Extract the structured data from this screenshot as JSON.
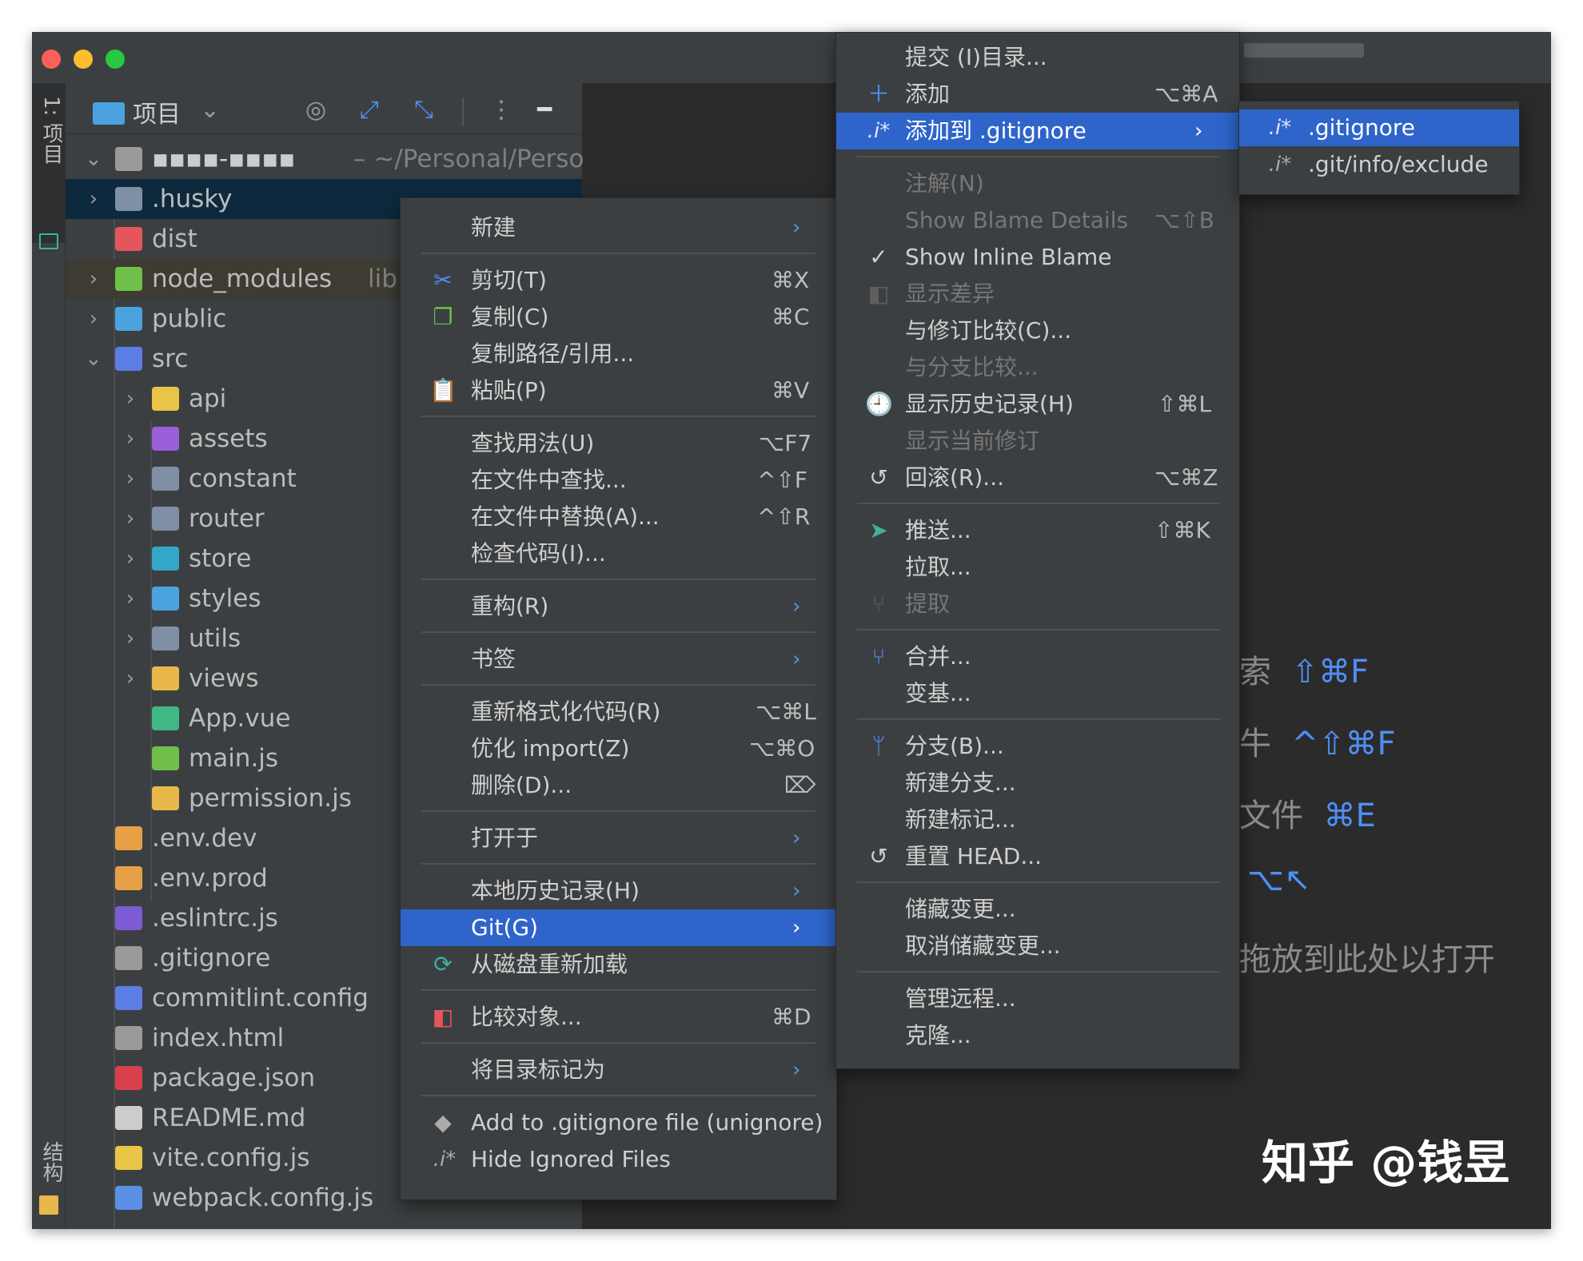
{
  "project_panel": {
    "tab_label": "1: 项目",
    "structure_tab_label": "结构",
    "toolbar_label": "项目",
    "toolbar_chevron": "⌄",
    "root_name": "▪▪▪▪-▪▪▪▪",
    "root_path": "~/Personal/Perso",
    "items": [
      {
        "name": ".husky",
        "icon_color": "#7f8fa6"
      },
      {
        "name": "dist",
        "icon_color": "#e5565c"
      },
      {
        "name": "node_modules",
        "sub": "lib",
        "icon_color": "#6fbf4a"
      },
      {
        "name": "public",
        "icon_color": "#4aa3df"
      },
      {
        "name": "src",
        "icon_color": "#5b7ee5"
      },
      {
        "name": "api",
        "icon_color": "#e8c547"
      },
      {
        "name": "assets",
        "icon_color": "#9a5ed8"
      },
      {
        "name": "constant",
        "icon_color": "#7f8fa6"
      },
      {
        "name": "router",
        "icon_color": "#7f8fa6"
      },
      {
        "name": "store",
        "icon_color": "#34a6c8"
      },
      {
        "name": "styles",
        "icon_color": "#4aa3df"
      },
      {
        "name": "utils",
        "icon_color": "#7f8fa6"
      },
      {
        "name": "views",
        "icon_color": "#e8b84b"
      },
      {
        "name": "App.vue",
        "icon_color": "#41b883"
      },
      {
        "name": "main.js",
        "icon_color": "#6fbf4a"
      },
      {
        "name": "permission.js",
        "icon_color": "#e8b84b"
      },
      {
        "name": ".env.dev",
        "icon_color": "#e8a047"
      },
      {
        "name": ".env.prod",
        "icon_color": "#e8a047"
      },
      {
        "name": ".eslintrc.js",
        "icon_color": "#7e5bd6"
      },
      {
        "name": ".gitignore",
        "icon_color": "#9a9a9a"
      },
      {
        "name": "commitlint.config",
        "icon_color": "#5b7ee5"
      },
      {
        "name": "index.html",
        "icon_color": "#9a9a9a"
      },
      {
        "name": "package.json",
        "icon_color": "#d9404b"
      },
      {
        "name": "README.md",
        "icon_color": "#cccccc"
      },
      {
        "name": "vite.config.js",
        "icon_color": "#e8c547"
      },
      {
        "name": "webpack.config.js",
        "icon_color": "#5b8fe6"
      }
    ]
  },
  "context_menu": {
    "new": "新建",
    "cut": "剪切(T)",
    "cut_sc": "⌘X",
    "copy": "复制(C)",
    "copy_sc": "⌘C",
    "copy_path": "复制路径/引用...",
    "paste": "粘贴(P)",
    "paste_sc": "⌘V",
    "find_usages": "查找用法(U)",
    "find_usages_sc": "⌥F7",
    "find_in_files": "在文件中查找...",
    "find_in_files_sc": "^⇧F",
    "replace_in_files": "在文件中替换(A)...",
    "replace_in_files_sc": "^⇧R",
    "inspect_code": "检查代码(I)...",
    "refactor": "重构(R)",
    "bookmarks": "书签",
    "reformat": "重新格式化代码(R)",
    "reformat_sc": "⌥⌘L",
    "optimize_imports": "优化 import(Z)",
    "optimize_imports_sc": "⌥⌘O",
    "delete": "删除(D)...",
    "delete_sc": "⌦",
    "open_in": "打开于",
    "local_history": "本地历史记录(H)",
    "git": "Git(G)",
    "reload_from_disk": "从磁盘重新加载",
    "compare_with": "比较对象...",
    "compare_with_sc": "⌘D",
    "mark_directory_as": "将目录标记为",
    "add_to_gitignore_file": "Add to .gitignore file (unignore)",
    "hide_ignored_files": "Hide Ignored Files"
  },
  "git_menu": {
    "commit_directory": "提交 (I)目录...",
    "add": "添加",
    "add_sc": "⌥⌘A",
    "add_to_gitignore": "添加到 .gitignore",
    "annotate": "注解(N)",
    "show_blame_details": "Show Blame Details",
    "show_blame_details_sc": "⌥⇧B",
    "show_inline_blame": "Show Inline Blame",
    "show_diff": "显示差异",
    "compare_with_revision": "与修订比较(C)...",
    "compare_with_branch": "与分支比较...",
    "show_history": "显示历史记录(H)",
    "show_history_sc": "⇧⌘L",
    "show_current_revision": "显示当前修订",
    "rollback": "回滚(R)...",
    "rollback_sc": "⌥⌘Z",
    "push": "推送...",
    "push_sc": "⇧⌘K",
    "pull": "拉取...",
    "fetch": "提取",
    "merge": "合并...",
    "rebase": "变基...",
    "branches": "分支(B)...",
    "new_branch": "新建分支...",
    "new_tag": "新建标记...",
    "reset_head": "重置 HEAD...",
    "stash_changes": "储藏变更...",
    "unstash_changes": "取消储藏变更...",
    "manage_remotes": "管理远程...",
    "clone": "克隆..."
  },
  "gitignore_submenu": {
    "gitignore": ".gitignore",
    "git_info_exclude": ".git/info/exclude",
    "file_icon_label": ".i*"
  },
  "editor_hints": [
    {
      "text": "索",
      "key": "⇧⌘F"
    },
    {
      "text": "牛",
      "key": "^⇧⌘F"
    },
    {
      "text": "文件",
      "key": "⌘E"
    },
    {
      "text": "",
      "key": "⌥↖"
    },
    {
      "text": "拖放到此处以打开",
      "key": ""
    }
  ],
  "watermark": "知乎 @钱昱",
  "colors": {
    "highlight": "#2f65ca",
    "menu_bg": "#3c3f41",
    "editor_bg": "#2b2b2b",
    "accent_blue": "#4e8ff5"
  }
}
